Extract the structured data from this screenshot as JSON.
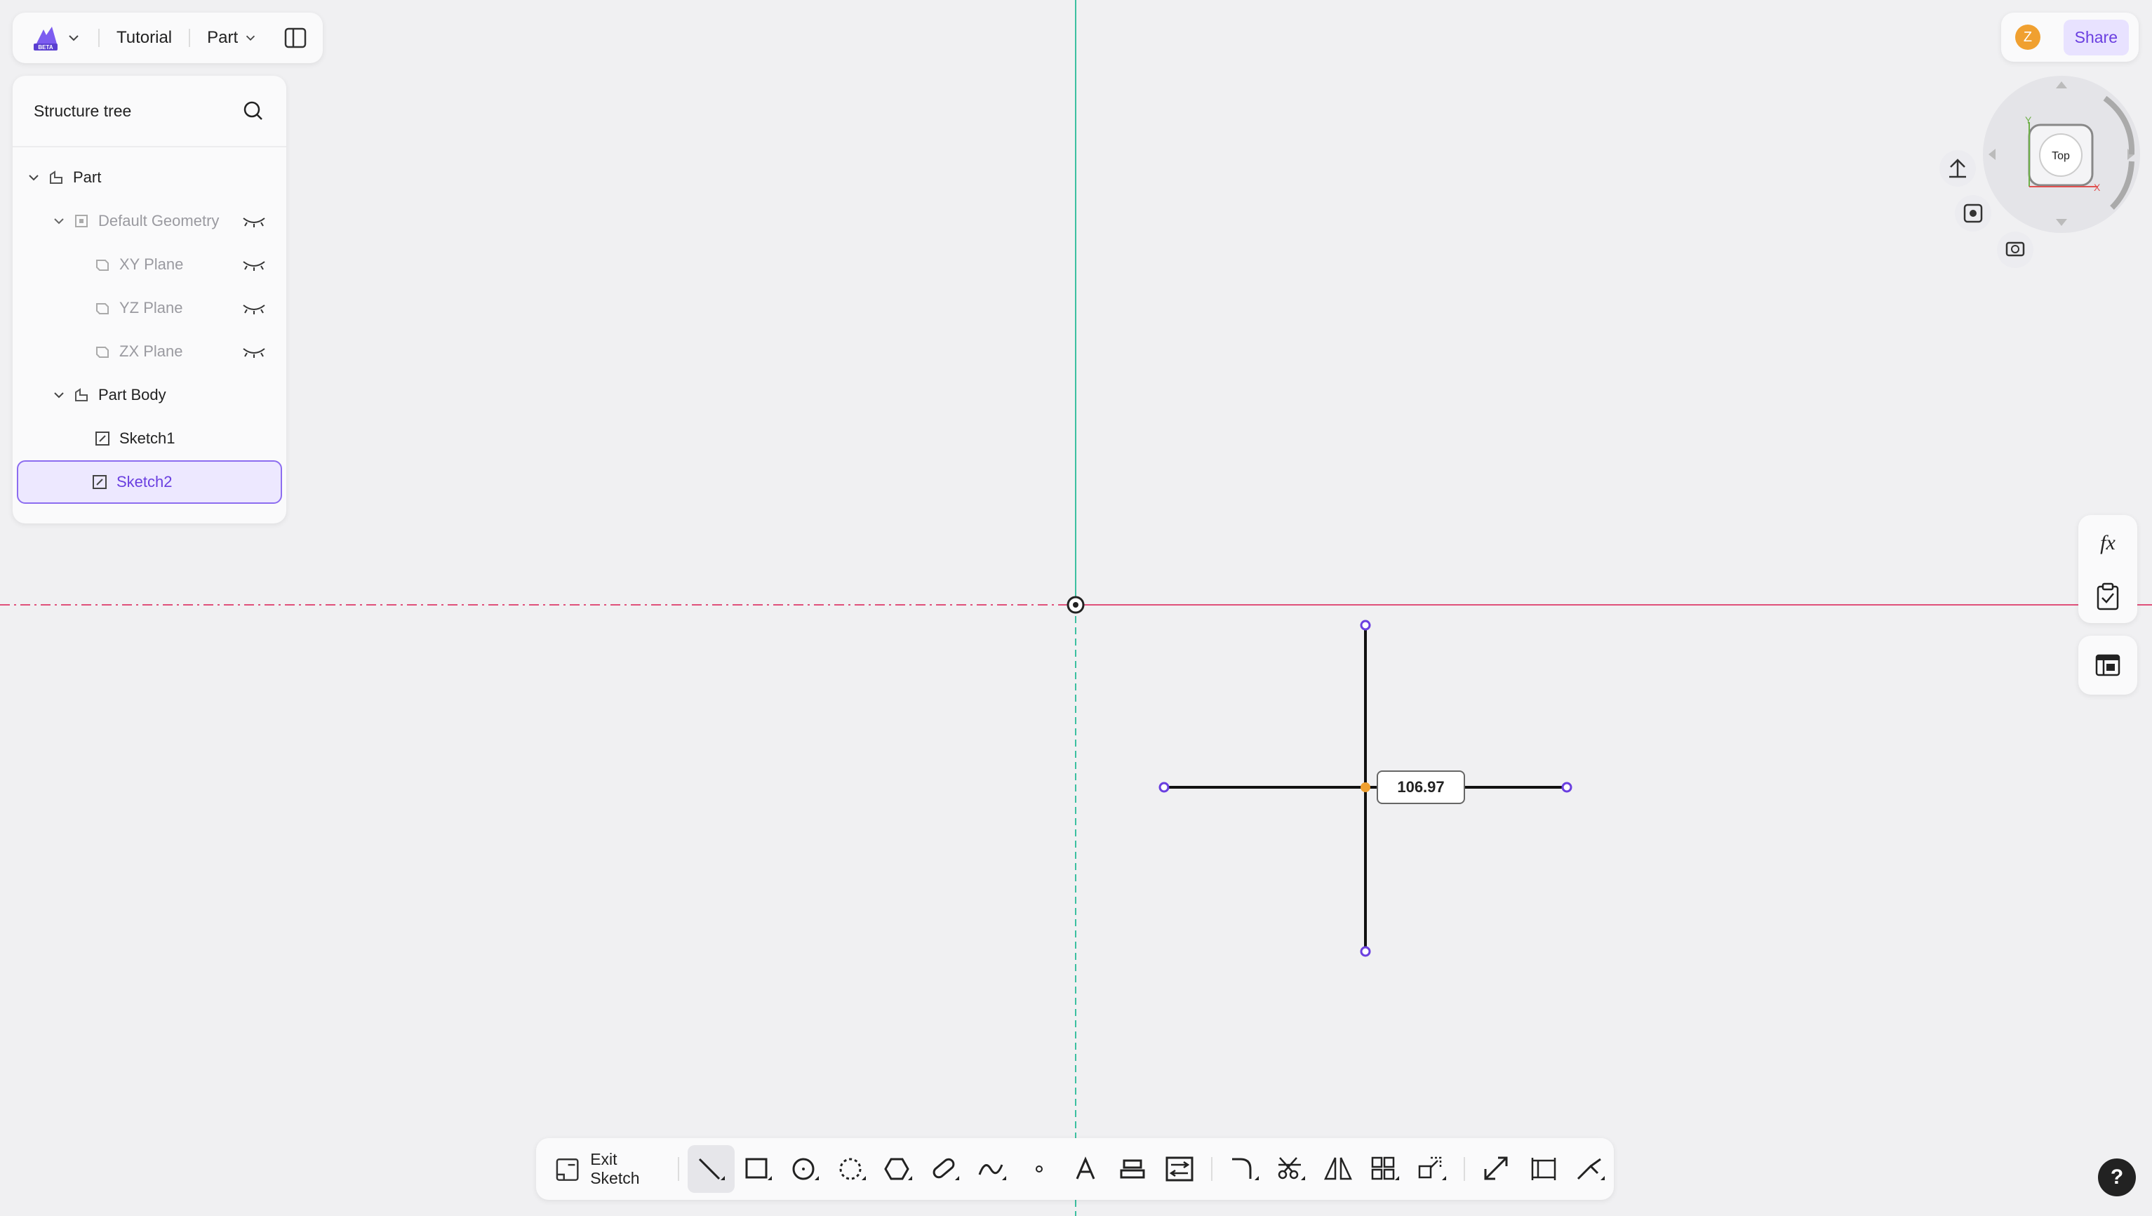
{
  "header": {
    "project_name": "Tutorial",
    "mode_label": "Part",
    "logo_badge": "BETA"
  },
  "structure_tree": {
    "title": "Structure tree",
    "items": [
      {
        "label": "Part",
        "level": 0,
        "expanded": true
      },
      {
        "label": "Default Geometry",
        "level": 1,
        "expanded": true,
        "hidden": true
      },
      {
        "label": "XY Plane",
        "level": 2,
        "hidden": true
      },
      {
        "label": "YZ Plane",
        "level": 2,
        "hidden": true
      },
      {
        "label": "ZX Plane",
        "level": 2,
        "hidden": true
      },
      {
        "label": "Part Body",
        "level": 1,
        "expanded": true
      },
      {
        "label": "Sketch1",
        "level": 2
      },
      {
        "label": "Sketch2",
        "level": 2,
        "selected": true
      }
    ]
  },
  "user": {
    "avatar_initial": "Z",
    "share_label": "Share"
  },
  "view_cube": {
    "face_label": "Top",
    "axis_x": "X",
    "axis_y": "Y"
  },
  "sketch": {
    "dimension_value": "106.97"
  },
  "toolbar": {
    "exit_label": "Exit Sketch",
    "tools": [
      "line-tool-icon",
      "rectangle-tool-icon",
      "circle-tool-icon",
      "arc-tool-icon",
      "polygon-tool-icon",
      "slot-tool-icon",
      "spline-tool-icon",
      "point-tool-icon",
      "text-tool-icon",
      "project-tool-icon",
      "offset-tool-icon",
      "fillet-tool-icon",
      "trim-tool-icon",
      "mirror-tool-icon",
      "pattern-tool-icon",
      "transform-tool-icon",
      "construction-tool-icon",
      "dimension-tool-icon",
      "constraint-tool-icon"
    ]
  },
  "colors": {
    "accent": "#6a3fe0",
    "x_axis": "#e0507a",
    "y_axis": "#3cc0a0"
  },
  "help_label": "?"
}
